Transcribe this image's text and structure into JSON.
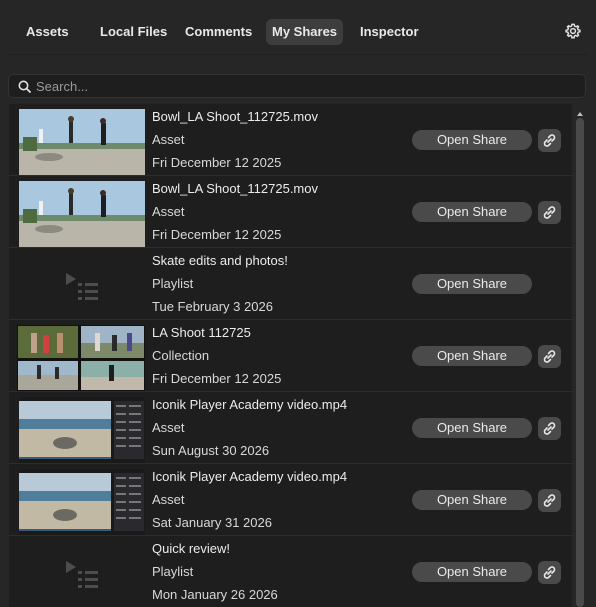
{
  "tabs": [
    {
      "label": "Assets",
      "active": false
    },
    {
      "label": "Local Files",
      "active": false
    },
    {
      "label": "Comments",
      "active": false
    },
    {
      "label": "My Shares",
      "active": true
    },
    {
      "label": "Inspector",
      "active": false
    }
  ],
  "settings_icon": "gear-icon",
  "search": {
    "placeholder": "Search...",
    "value": "",
    "icon": "search-icon"
  },
  "shares": [
    {
      "title": "Bowl_LA Shoot_112725.mov",
      "kind": "Asset",
      "date": "Fri December 12 2025",
      "thumbnail": "video-frame-skaters",
      "button": "Open Share",
      "has_link": true
    },
    {
      "title": "Bowl_LA Shoot_112725.mov",
      "kind": "Asset",
      "date": "Fri December 12 2025",
      "thumbnail": "video-frame-skaters",
      "button": "Open Share",
      "has_link": true
    },
    {
      "title": "Skate edits and photos!",
      "kind": "Playlist",
      "date": "Tue February 3 2026",
      "thumbnail": "playlist-icon",
      "button": "Open Share",
      "has_link": false
    },
    {
      "title": "LA Shoot 112725",
      "kind": "Collection",
      "date": "Fri December 12 2025",
      "thumbnail": "collection-grid",
      "button": "Open Share",
      "has_link": true
    },
    {
      "title": "Iconik Player Academy video.mp4",
      "kind": "Asset",
      "date": "Sun August 30 2026",
      "thumbnail": "video-frame-screen",
      "button": "Open Share",
      "has_link": true
    },
    {
      "title": "Iconik Player Academy video.mp4",
      "kind": "Asset",
      "date": "Sat January 31 2026",
      "thumbnail": "video-frame-screen",
      "button": "Open Share",
      "has_link": true
    },
    {
      "title": "Quick review!",
      "kind": "Playlist",
      "date": "Mon January 26 2026",
      "thumbnail": "playlist-icon",
      "button": "Open Share",
      "has_link": true
    }
  ]
}
